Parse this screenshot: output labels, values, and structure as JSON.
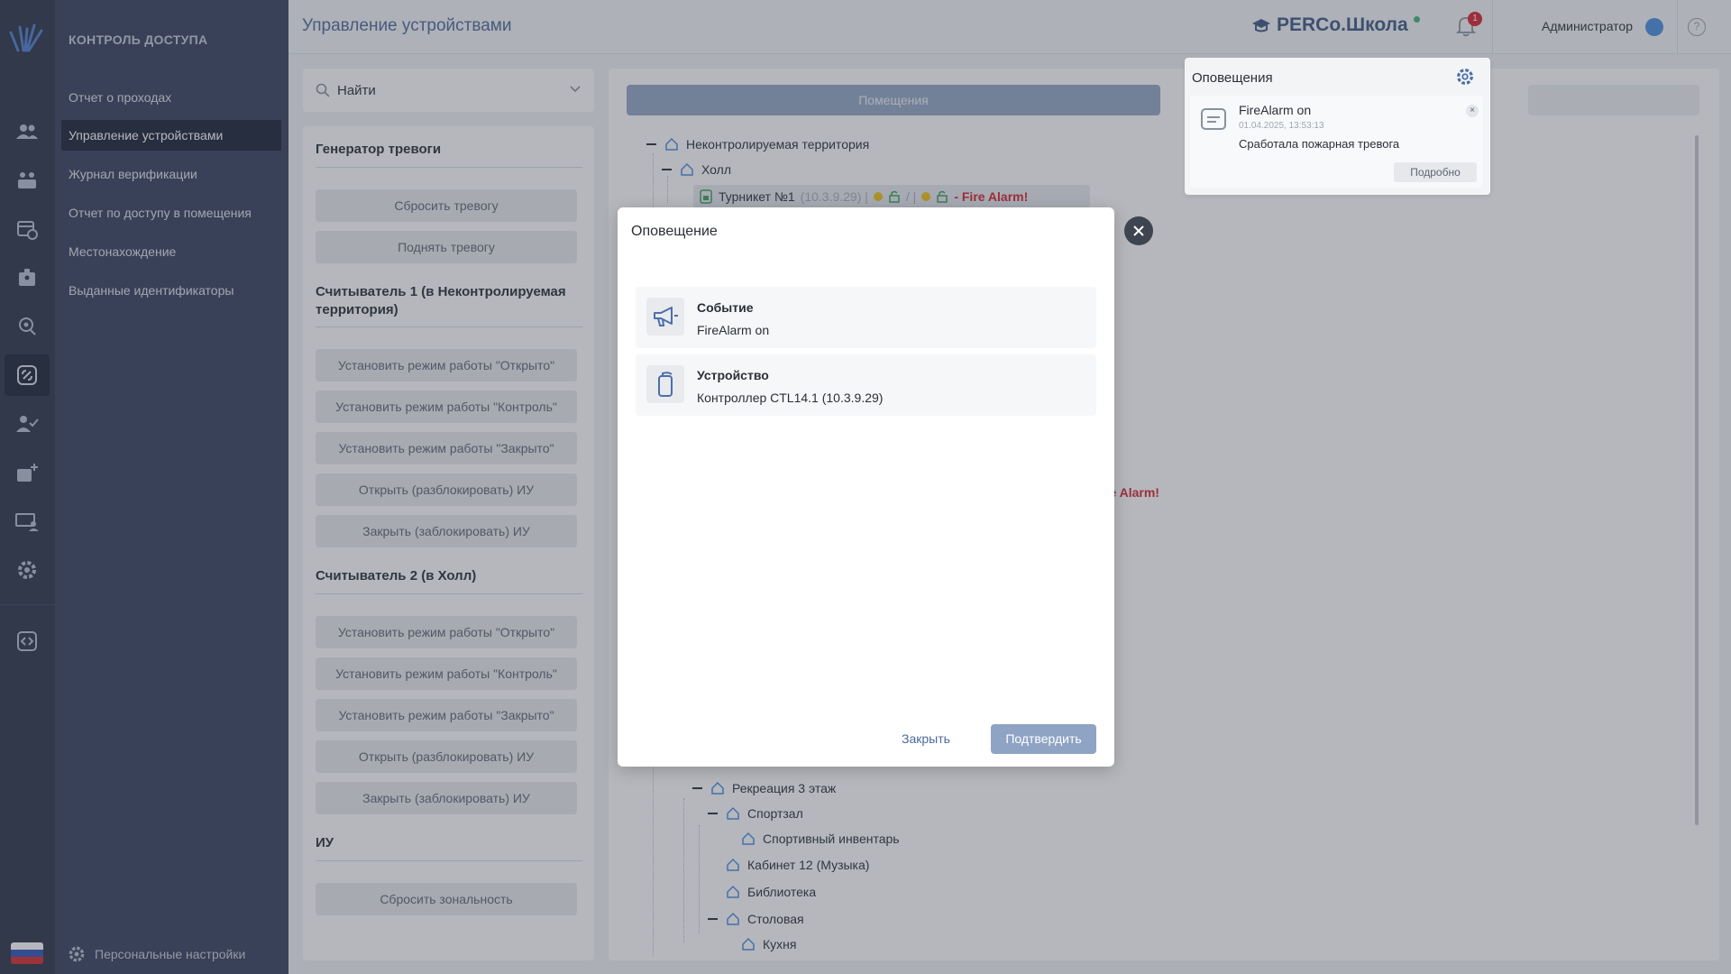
{
  "nav": {
    "section": "КОНТРОЛЬ ДОСТУПА",
    "items": [
      {
        "label": "Отчет о проходах"
      },
      {
        "label": "Управление устройствами"
      },
      {
        "label": "Журнал верификации"
      },
      {
        "label": "Отчет по доступу в помещения"
      },
      {
        "label": "Местонахождение"
      },
      {
        "label": "Выданные идентификаторы"
      }
    ],
    "active_index": 1,
    "personal_settings": "Персональные настройки"
  },
  "header": {
    "title": "Управление устройствами",
    "brand": "PERCo.Школа",
    "notif_count": "1",
    "user": "Администратор",
    "help": "?"
  },
  "left_panel": {
    "search_label": "Найти",
    "sections": [
      {
        "title": "Генератор тревоги",
        "buttons": [
          "Сбросить тревогу",
          "Поднять тревогу"
        ]
      },
      {
        "title": "Считыватель 1 (в Неконтролируемая территория)",
        "buttons": [
          "Установить режим работы \"Открыто\"",
          "Установить режим работы \"Контроль\"",
          "Установить режим работы \"Закрыто\"",
          "Открыть (разблокировать) ИУ",
          "Закрыть (заблокировать) ИУ"
        ]
      },
      {
        "title": "Считыватель 2 (в Холл)",
        "buttons": [
          "Установить режим работы \"Открыто\"",
          "Установить режим работы \"Контроль\"",
          "Установить режим работы \"Закрыто\"",
          "Открыть (разблокировать) ИУ",
          "Закрыть (заблокировать) ИУ"
        ]
      },
      {
        "title": "ИУ",
        "buttons": [
          "Сбросить зональность"
        ]
      }
    ]
  },
  "tree": {
    "tab": "Помещения",
    "nodes": {
      "root": "Неконтролируемая территория",
      "hall": "Холл",
      "turnstile_name": "Турникет №1",
      "turnstile_ip": "(10.3.9.29) |",
      "turnstile_sep": "/ |",
      "fire_alarm": "- Fire Alarm!",
      "fire_alarm_partial": "re Alarm!",
      "rec3": "Рекреация 3 этаж",
      "gym": "Спортзал",
      "equip": "Спортивный инвентарь",
      "music": "Кабинет 12 (Музыка)",
      "library": "Библиотека",
      "canteen": "Столовая",
      "kitchen": "Кухня"
    }
  },
  "notifications": {
    "title": "Оповещения",
    "card": {
      "title": "FireAlarm on",
      "date": "01.04.2025, 13:53:13",
      "text": "Сработала пожарная тревога",
      "details": "Подробно",
      "close": "×"
    }
  },
  "modal": {
    "title": "Оповещение",
    "event_label": "Событие",
    "event_value": "FireAlarm on",
    "device_label": "Устройство",
    "device_value": "Контроллер CTL14.1 (10.3.9.29)",
    "close_label": "Закрыть",
    "confirm_label": "Подтвердить"
  },
  "colors": {
    "rail": "#2a3448",
    "nav": "#36415c",
    "accent": "#4e6a9c",
    "alarm": "#d6242e"
  }
}
